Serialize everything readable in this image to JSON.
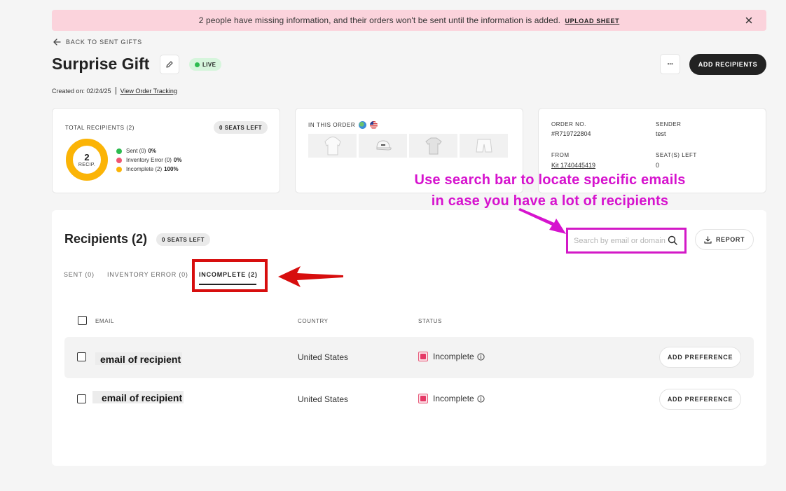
{
  "banner": {
    "message": "2 people have missing information, and their orders won't be sent until the information is added.",
    "link": "UPLOAD SHEET"
  },
  "header": {
    "back_label": "BACK TO SENT GIFTS",
    "title": "Surprise Gift",
    "status_badge": "LIVE",
    "created_text": "Created on: 02/24/25",
    "tracking_link": "View Order Tracking",
    "more_label": "···",
    "add_recipients": "ADD RECIPIENTS"
  },
  "summary": {
    "total_label": "TOTAL RECIPIENTS (2)",
    "seats_left": "0 SEATS LEFT",
    "donut_value": "2",
    "donut_label": "RECIP.",
    "legend": [
      {
        "label": "Sent (0)",
        "pct": "0%",
        "color": "#2dbb4f"
      },
      {
        "label": "Inventory Error (0)",
        "pct": "0%",
        "color": "#ef5571"
      },
      {
        "label": "Incomplete (2)",
        "pct": "100%",
        "color": "#fbb406"
      }
    ],
    "incomplete_fraction": 1.0
  },
  "order_items": {
    "label": "IN THIS ORDER",
    "items": [
      "hoodie",
      "cap",
      "t-shirt",
      "shorts"
    ]
  },
  "order_info": {
    "order_no_label": "ORDER NO.",
    "order_no": "#R719722804",
    "sender_label": "SENDER",
    "sender": "test",
    "from_label": "FROM",
    "from": "Kit 1740445419",
    "seats_label": "SEAT(S) LEFT",
    "seats": "0"
  },
  "recipients": {
    "title": "Recipients (2)",
    "seats_badge": "0 SEATS LEFT",
    "search_placeholder": "Search by email or domain",
    "report": "REPORT",
    "tabs": [
      {
        "label": "SENT (0)"
      },
      {
        "label": "INVENTORY ERROR (0)"
      },
      {
        "label": "INCOMPLETE (2)"
      }
    ],
    "columns": {
      "email": "EMAIL",
      "country": "COUNTRY",
      "status": "STATUS"
    },
    "rows": [
      {
        "email": "email of recipient",
        "country": "United States",
        "status": "Incomplete",
        "action": "ADD PREFERENCE"
      },
      {
        "email": "email of recipient",
        "country": "United States",
        "status": "Incomplete",
        "action": "ADD PREFERENCE"
      }
    ]
  },
  "annotation": {
    "line1": "Use search bar to locate specific emails",
    "line2": "in case you have a lot of recipients"
  },
  "colors": {
    "banner_bg": "#fbd3dc",
    "annotation": "#d613ce",
    "highlight_red": "#d70e0e",
    "donut": "#fbb406"
  }
}
